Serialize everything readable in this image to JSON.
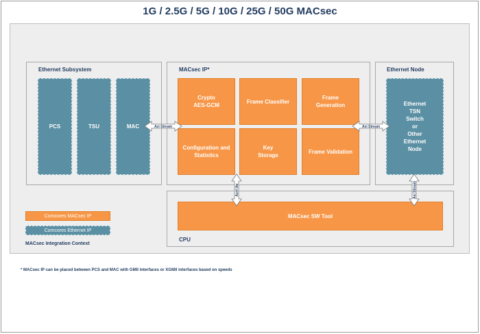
{
  "title": "1G / 2.5G / 5G / 10G / 25G / 50G MACsec",
  "panels": {
    "ethernet_subsystem": "Ethernet Subsystem",
    "macsec_ip": "MACsec IP*",
    "ethernet_node": "Ethernet Node",
    "cpu": "CPU"
  },
  "ethernet_subsystem_blocks": [
    "PCS",
    "TSU",
    "MAC"
  ],
  "macsec_blocks": [
    "Crypto\nAES-GCM",
    "Frame Classifier",
    "Frame\nGeneration",
    "Configuration and\nStatistics",
    "Key\nStorage",
    "Frame Validation"
  ],
  "ethernet_node_block": [
    "Ethernet",
    "TSN",
    "Switch",
    "or",
    "Other",
    "Ethernet",
    "Node"
  ],
  "sw_tool": "MACsec SW Tool",
  "arrows": {
    "axi_stream_left": "Axi Stream",
    "axi_stream_right": "Axi Stream",
    "axi4_lite": "Axi4 lite",
    "axi_stream_vertical": "Axi Stream"
  },
  "legend": {
    "comcores_macsec_ip": "Comcores MACsec IP",
    "comcores_ethernet_ip": "Comcores Ethernet IP"
  },
  "context_label": "MACsec Integration Context",
  "footnote": "* MACsec IP can be placed between PCS and MAC with GMII interfaces or XGMII interfaces based on speeds",
  "colors": {
    "orange": "#f79646",
    "blue": "#5b8fa3",
    "title": "#1f3a5f"
  }
}
